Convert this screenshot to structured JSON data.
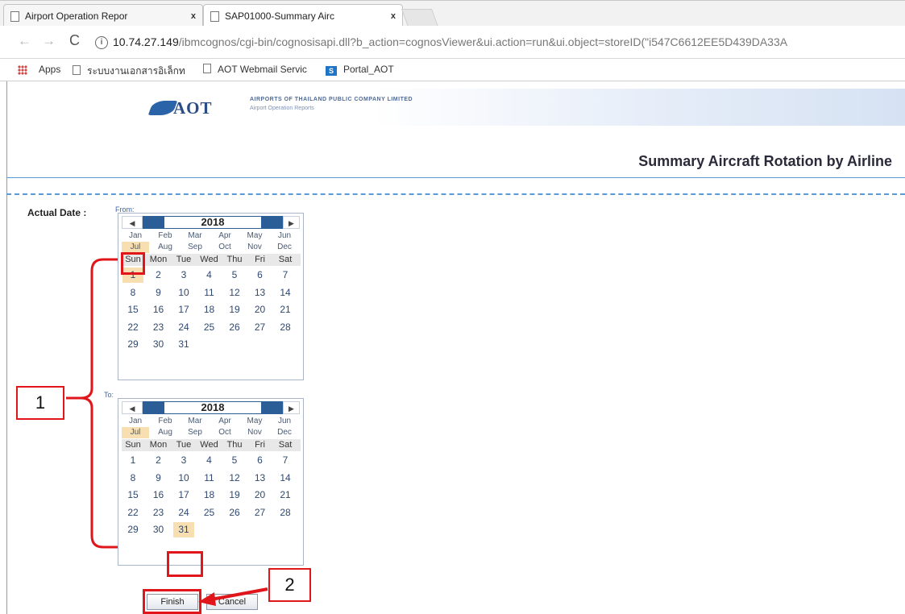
{
  "browser": {
    "tabs": [
      {
        "title": "Airport Operation Repor",
        "close": "x"
      },
      {
        "title": "SAP01000-Summary Airc",
        "close": "x"
      }
    ],
    "nav": {
      "back": "←",
      "forward": "→",
      "reload": "C"
    },
    "url": {
      "info": "i",
      "host": "10.74.27.149",
      "path": "/ibmcognos/cgi-bin/cognosisapi.dll?b_action=cognosViewer&ui.action=run&ui.object=storeID(\"i547C6612EE5D439DA33A"
    },
    "bookmarks": [
      {
        "label": "Apps",
        "icon": "apps-grid-icon"
      },
      {
        "label": "ระบบงานเอกสารอิเล็กท",
        "icon": "page-icon"
      },
      {
        "label": "AOT Webmail Servic",
        "icon": "page-icon"
      },
      {
        "label": "Portal_AOT",
        "icon": "sharepoint-icon"
      }
    ]
  },
  "banner": {
    "logo_text": "AOT",
    "company": "AIRPORTS OF THAILAND PUBLIC COMPANY LIMITED",
    "subtitle": "Airport Operation Reports"
  },
  "report": {
    "title": "Summary Aircraft Rotation by Airline",
    "actual_date_label": "Actual Date :",
    "from_label": "From:",
    "to_label": "To:"
  },
  "calendar_from": {
    "prev": "◀",
    "next": "▶",
    "year": "2018",
    "months": [
      "Jan",
      "Feb",
      "Mar",
      "Apr",
      "May",
      "Jun",
      "Jul",
      "Aug",
      "Sep",
      "Oct",
      "Nov",
      "Dec"
    ],
    "selected_month": "Jul",
    "weekdays": [
      "Sun",
      "Mon",
      "Tue",
      "Wed",
      "Thu",
      "Fri",
      "Sat"
    ],
    "days": [
      "1",
      "2",
      "3",
      "4",
      "5",
      "6",
      "7",
      "8",
      "9",
      "10",
      "11",
      "12",
      "13",
      "14",
      "15",
      "16",
      "17",
      "18",
      "19",
      "20",
      "21",
      "22",
      "23",
      "24",
      "25",
      "26",
      "27",
      "28",
      "29",
      "30",
      "31"
    ],
    "first_weekday": 0,
    "selected_day": "1"
  },
  "calendar_to": {
    "prev": "◀",
    "next": "▶",
    "year": "2018",
    "months": [
      "Jan",
      "Feb",
      "Mar",
      "Apr",
      "May",
      "Jun",
      "Jul",
      "Aug",
      "Sep",
      "Oct",
      "Nov",
      "Dec"
    ],
    "selected_month": "Jul",
    "weekdays": [
      "Sun",
      "Mon",
      "Tue",
      "Wed",
      "Thu",
      "Fri",
      "Sat"
    ],
    "days": [
      "1",
      "2",
      "3",
      "4",
      "5",
      "6",
      "7",
      "8",
      "9",
      "10",
      "11",
      "12",
      "13",
      "14",
      "15",
      "16",
      "17",
      "18",
      "19",
      "20",
      "21",
      "22",
      "23",
      "24",
      "25",
      "26",
      "27",
      "28",
      "29",
      "30",
      "31"
    ],
    "first_weekday": 0,
    "selected_day": "31"
  },
  "buttons": {
    "finish": "Finish",
    "cancel": "Cancel"
  },
  "annotations": {
    "step1": "1",
    "step2": "2"
  },
  "colors": {
    "accent_blue": "#2b5d97",
    "selected": "#f7dfb1",
    "annotation_red": "#e0161b"
  }
}
